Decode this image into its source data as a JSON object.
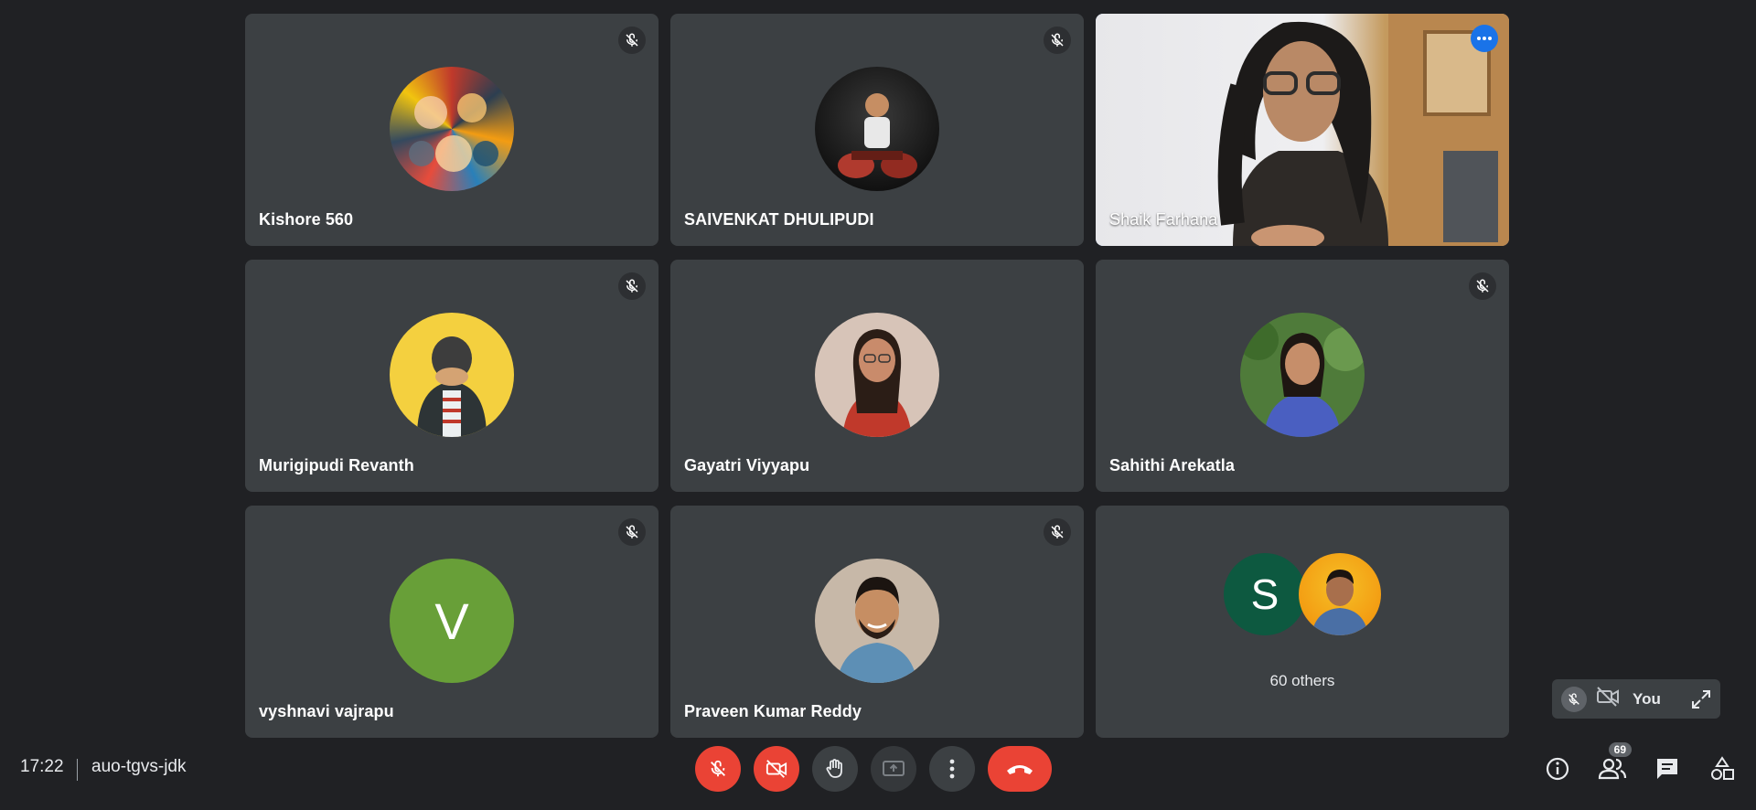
{
  "participants": [
    {
      "name": "Kishore 560",
      "muted": true,
      "avatar": "anime-collage-avatar"
    },
    {
      "name": "SAIVENKAT DHULIPUDI",
      "muted": true,
      "avatar": "motorbike-photo-avatar"
    },
    {
      "name": "Shaik Farhana",
      "muted": false,
      "speaking": true,
      "video": true
    },
    {
      "name": "Murigipudi Revanth",
      "muted": true,
      "avatar": "yellow-bg-photo-avatar"
    },
    {
      "name": "Gayatri Viyyapu",
      "muted": false,
      "avatar": "portrait-photo-avatar"
    },
    {
      "name": "Sahithi Arekatla",
      "muted": true,
      "avatar": "garden-photo-avatar"
    },
    {
      "name": "vyshnavi vajrapu",
      "muted": true,
      "initial": "V",
      "color": "#689f38"
    },
    {
      "name": "Praveen Kumar Reddy",
      "muted": true,
      "avatar": "portrait-photo-avatar"
    }
  ],
  "others": {
    "label": "60 others",
    "first_initial": "S",
    "first_color": "#0d5940"
  },
  "self_view": {
    "label": "You"
  },
  "bottom_bar": {
    "time": "17:22",
    "meeting_code": "auo-tgvs-jdk",
    "people_count": "69"
  },
  "colors": {
    "background": "#202124",
    "tile": "#3c4043",
    "danger": "#ea4335",
    "speaking_border": "#8ab4f8",
    "accent": "#1a73e8"
  }
}
